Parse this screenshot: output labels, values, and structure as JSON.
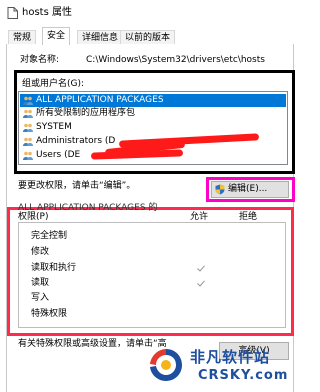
{
  "window": {
    "title": "hosts 属性"
  },
  "tabs": [
    {
      "label": "常规"
    },
    {
      "label": "安全"
    },
    {
      "label": "详细信息"
    },
    {
      "label": "以前的版本"
    }
  ],
  "object_name": {
    "label": "对象名称:",
    "value": "C:\\Windows\\System32\\drivers\\etc\\hosts"
  },
  "groups": {
    "label": "组或用户名(G):",
    "items": [
      {
        "label": "ALL APPLICATION PACKAGES",
        "icon": "group-icon"
      },
      {
        "label": "所有受限制的应用程序包",
        "icon": "group-icon"
      },
      {
        "label": "SYSTEM",
        "icon": "group-icon"
      },
      {
        "label": "Administrators (D",
        "icon": "group-icon"
      },
      {
        "label": "Users (DE",
        "icon": "group-icon"
      }
    ]
  },
  "edit": {
    "prompt": "要更改权限，请单击“编辑”。",
    "button_label": "编辑(E)..."
  },
  "permissions": {
    "heading": "ALL APPLICATION PACKAGES 的",
    "title_label": "权限(P)",
    "allow_label": "允许",
    "deny_label": "拒绝",
    "rows": [
      {
        "label": "完全控制",
        "allow": false
      },
      {
        "label": "修改",
        "allow": false
      },
      {
        "label": "读取和执行",
        "allow": true
      },
      {
        "label": "读取",
        "allow": true
      },
      {
        "label": "写入",
        "allow": false
      },
      {
        "label": "特殊权限",
        "allow": false
      }
    ]
  },
  "footer": {
    "line1": "有关特殊权限或高级设置，请单击“高",
    "advanced_button_label": "高级(V)"
  },
  "watermark": {
    "name": "非凡软件站",
    "url": "CRSKY.com"
  },
  "colors": {
    "selection": "#0078d7",
    "highlight_black": "#000000",
    "highlight_magenta": "#ff00c8",
    "highlight_red": "#ff2b4d",
    "redaction": "#ff1a1a",
    "watermark": "#1d4f9e"
  }
}
